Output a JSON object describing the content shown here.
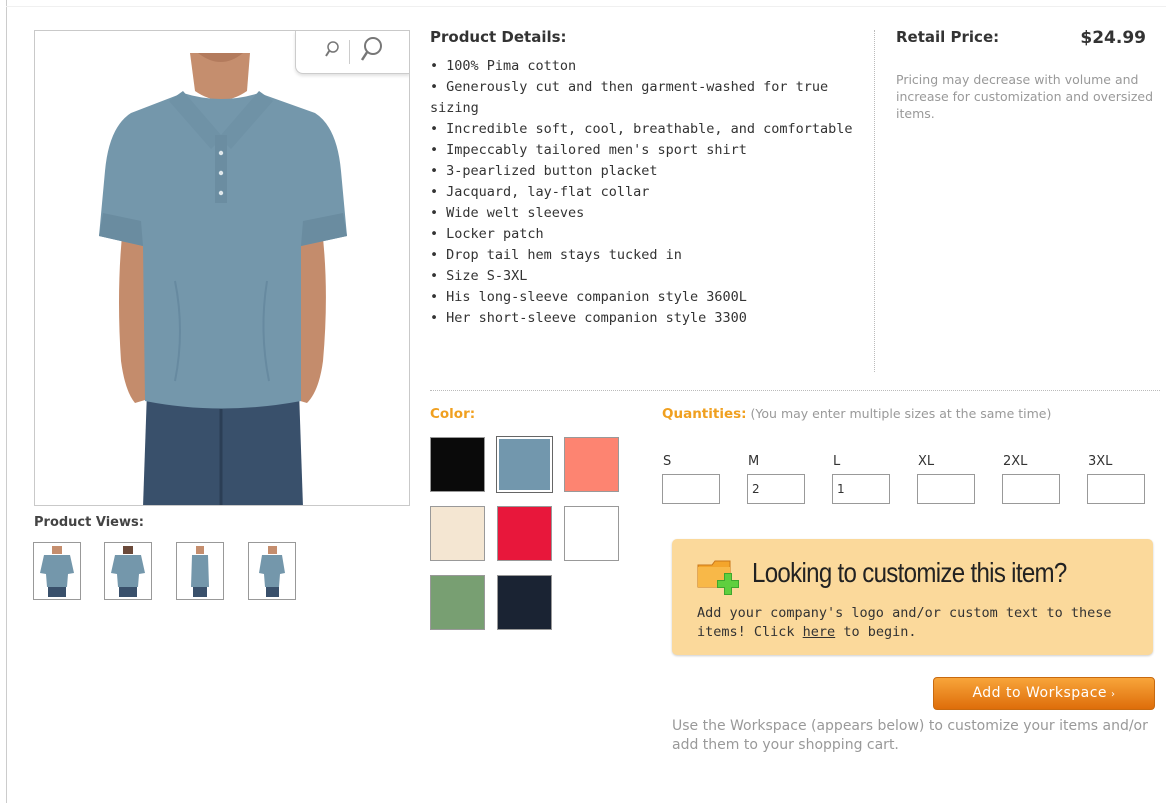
{
  "product_views_label": "Product Views:",
  "details": {
    "title": "Product Details:",
    "bullet": "•",
    "items": [
      "100% Pima cotton",
      "Generously cut and then garment-washed for true sizing",
      "Incredible soft, cool, breathable, and comfortable",
      "Impeccably tailored men's sport shirt",
      "3-pearlized button placket",
      "Jacquard, lay-flat collar",
      "Wide welt sleeves",
      "Locker patch",
      "Drop tail hem stays tucked in",
      "Size S-3XL",
      "His long-sleeve companion style 3600L",
      "Her short-sleeve companion style 3300"
    ]
  },
  "price": {
    "label": "Retail Price:",
    "value": "$24.99",
    "note": "Pricing may decrease with volume and increase for customization and oversized items."
  },
  "color": {
    "label": "Color:",
    "swatches": [
      {
        "name": "black",
        "hex": "#0a0a0a"
      },
      {
        "name": "slate-blue",
        "hex": "#7297ad",
        "selected": true
      },
      {
        "name": "coral",
        "hex": "#fd8471"
      },
      {
        "name": "cream",
        "hex": "#f4e6d2"
      },
      {
        "name": "red",
        "hex": "#e8173b"
      },
      {
        "name": "white",
        "hex": "#ffffff"
      },
      {
        "name": "sage-green",
        "hex": "#789f72"
      },
      {
        "name": "navy",
        "hex": "#1a2333"
      }
    ]
  },
  "quantities": {
    "label": "Quantities:",
    "note": "(You may enter multiple sizes at the same time)",
    "sizes": [
      {
        "label": "S",
        "value": ""
      },
      {
        "label": "M",
        "value": "2"
      },
      {
        "label": "L",
        "value": "1"
      },
      {
        "label": "XL",
        "value": ""
      },
      {
        "label": "2XL",
        "value": ""
      },
      {
        "label": "3XL",
        "value": ""
      }
    ]
  },
  "customize": {
    "title": "Looking to customize this item?",
    "text_before": "Add your company's logo and/or custom text to these items! Click ",
    "link": "here",
    "text_after": " to begin."
  },
  "add_button": "Add to Workspace",
  "workspace_note": "Use the Workspace (appears below) to customize your items and/or add them to your shopping cart.",
  "icons": {
    "zoom_out": "zoom-out-icon",
    "zoom_in": "zoom-in-icon",
    "customize": "add-to-folder-icon",
    "arrow": "chevron-right-icon"
  },
  "colors": {
    "accent_orange": "#f0a020",
    "shirt": "#7497ab",
    "jeans": "#39506b",
    "customize_bg": "#fbd99b"
  }
}
